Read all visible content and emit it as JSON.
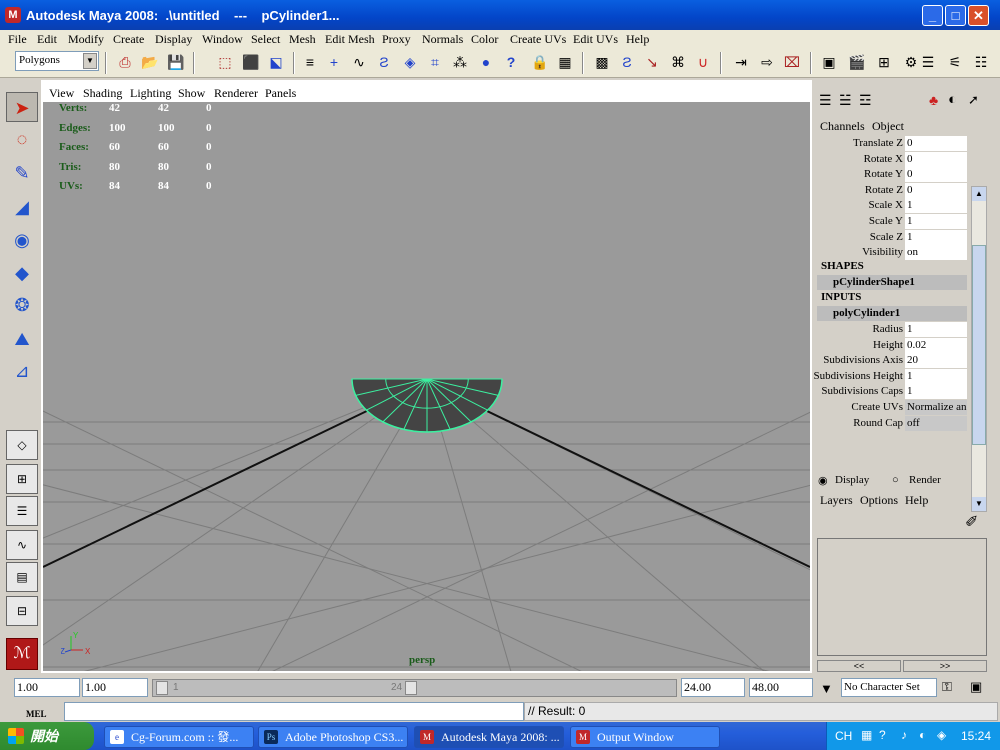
{
  "window": {
    "title": "Autodesk Maya 2008:  .\\untitled    ---    pCylinder1...",
    "icon": "maya-icon"
  },
  "menu": [
    "File",
    "Edit",
    "Modify",
    "Create",
    "Display",
    "Window",
    "Select",
    "Mesh",
    "Edit Mesh",
    "Proxy",
    "Normals",
    "Color",
    "Create UVs",
    "Edit UVs",
    "Help"
  ],
  "mode_selector": "Polygons",
  "viewport": {
    "menu": [
      "View",
      "Shading",
      "Lighting",
      "Show",
      "Renderer",
      "Panels"
    ],
    "hud": [
      {
        "label": "Verts:",
        "a": "42",
        "b": "42",
        "c": "0"
      },
      {
        "label": "Edges:",
        "a": "100",
        "b": "100",
        "c": "0"
      },
      {
        "label": "Faces:",
        "a": "60",
        "b": "60",
        "c": "0"
      },
      {
        "label": "Tris:",
        "a": "80",
        "b": "80",
        "c": "0"
      },
      {
        "label": "UVs:",
        "a": "84",
        "b": "84",
        "c": "0"
      }
    ],
    "camera": "persp",
    "axis": {
      "x": "X",
      "y": "Y",
      "z": "Z"
    },
    "colors": {
      "background": "#9a9a9a",
      "grid": "#7e7e7e",
      "axis_lines": "#111111",
      "selection": "#3cf0a0"
    }
  },
  "channel_box": {
    "tabs": [
      "Channels",
      "Object"
    ],
    "transform": [
      {
        "label": "Translate Z",
        "value": "0"
      },
      {
        "label": "Rotate X",
        "value": "0"
      },
      {
        "label": "Rotate Y",
        "value": "0"
      },
      {
        "label": "Rotate Z",
        "value": "0"
      },
      {
        "label": "Scale X",
        "value": "1"
      },
      {
        "label": "Scale Y",
        "value": "1"
      },
      {
        "label": "Scale Z",
        "value": "1"
      },
      {
        "label": "Visibility",
        "value": "on"
      }
    ],
    "shapes_header": "SHAPES",
    "shape_node": "pCylinderShape1",
    "inputs_header": "INPUTS",
    "input_node": "polyCylinder1",
    "inputs": [
      {
        "label": "Radius",
        "value": "1"
      },
      {
        "label": "Height",
        "value": "0.02"
      },
      {
        "label": "Subdivisions Axis",
        "value": "20"
      },
      {
        "label": "Subdivisions Height",
        "value": "1"
      },
      {
        "label": "Subdivisions Caps",
        "value": "1"
      },
      {
        "label": "Create UVs",
        "value": "Normalize an"
      },
      {
        "label": "Round Cap",
        "value": "off"
      }
    ]
  },
  "layer_editor": {
    "display": "Display",
    "render": "Render",
    "menu": [
      "Layers",
      "Options",
      "Help"
    ],
    "prev": "<<",
    "next": ">>"
  },
  "time": {
    "start": "1.00",
    "current": "1.00",
    "slider_start": "1",
    "slider_end": "24",
    "end": "24.00",
    "range_end": "48.00",
    "character_set": "No Character Set"
  },
  "command": {
    "mel": "MEL",
    "result": "// Result: 0"
  },
  "taskbar": {
    "start": "開始",
    "items": [
      {
        "label": "Cg-Forum.com :: 發...",
        "icon": "ie-icon"
      },
      {
        "label": "Adobe Photoshop CS3...",
        "icon": "photoshop-icon"
      },
      {
        "label": "Autodesk Maya 2008: ...",
        "icon": "maya-icon"
      },
      {
        "label": "Output Window",
        "icon": "maya-icon"
      }
    ],
    "lang": "CH",
    "clock": "15:24"
  }
}
